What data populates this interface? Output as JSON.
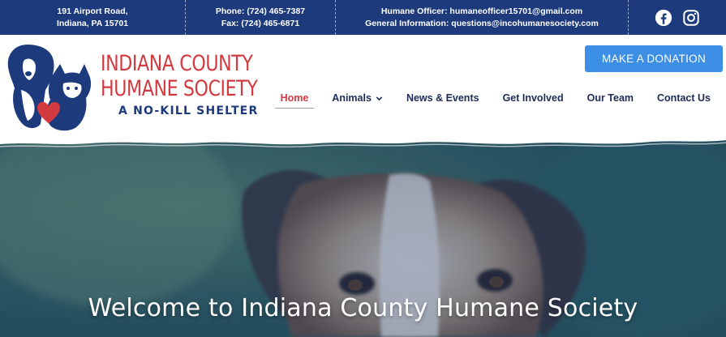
{
  "topbar": {
    "address_line1": "191 Airport Road,",
    "address_line2": "Indiana, PA 15701",
    "phone": "Phone: (724) 465-7387",
    "fax": "Fax: (724) 465-6871",
    "humane_officer": "Humane Officer:  humaneofficer15701@gmail.com",
    "general_info": "General Information:  questions@incohumanesociety.com",
    "social": [
      {
        "name": "facebook",
        "icon": "facebook-icon"
      },
      {
        "name": "instagram",
        "icon": "instagram-icon"
      }
    ]
  },
  "logo": {
    "line1": "INDIANA COUNTY",
    "line2": "HUMANE SOCIETY",
    "tagline": "A NO-KILL SHELTER",
    "art_icons": [
      "dog-silhouette",
      "cat-silhouette",
      "heart-icon"
    ]
  },
  "donate": {
    "label": "MAKE A DONATION"
  },
  "nav": {
    "items": [
      {
        "label": "Home",
        "active": true
      },
      {
        "label": "Animals",
        "has_dropdown": true
      },
      {
        "label": "News & Events"
      },
      {
        "label": "Get Involved"
      },
      {
        "label": "Our Team"
      },
      {
        "label": "Contact Us"
      }
    ]
  },
  "hero": {
    "title": "Welcome to Indiana County Humane Society"
  },
  "colors": {
    "topbar_bg": "#1d3a7d",
    "brand_red": "#d23a3f",
    "brand_navy": "#1d3a7d",
    "donate_bg": "#3d8fe5",
    "nav_text": "#1d2b55"
  }
}
